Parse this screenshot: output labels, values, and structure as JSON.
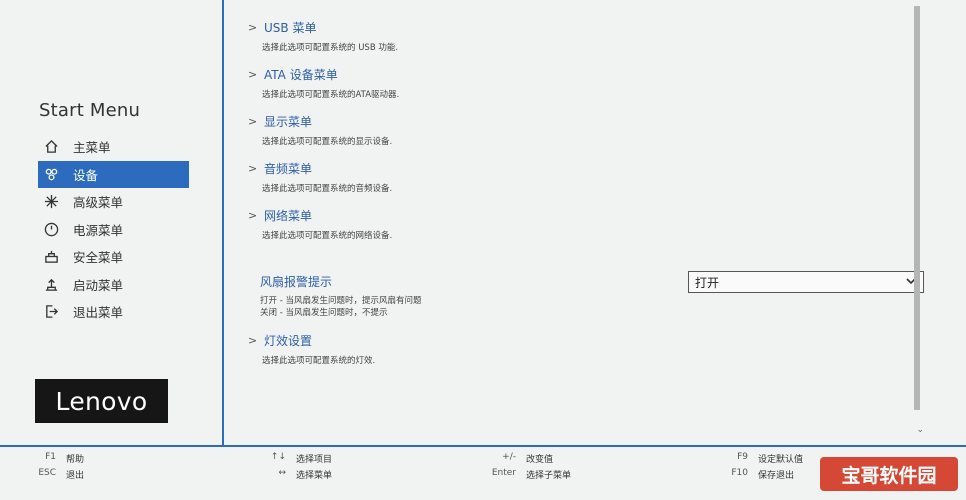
{
  "sidebar": {
    "title": "Start Menu",
    "items": [
      {
        "label": "主菜单",
        "icon": "home-icon"
      },
      {
        "label": "设备",
        "icon": "devices-icon",
        "active": true
      },
      {
        "label": "高级菜单",
        "icon": "advanced-icon"
      },
      {
        "label": "电源菜单",
        "icon": "power-icon"
      },
      {
        "label": "安全菜单",
        "icon": "security-icon"
      },
      {
        "label": "启动菜单",
        "icon": "startup-icon"
      },
      {
        "label": "退出菜单",
        "icon": "exit-icon"
      }
    ],
    "logo": "Lenovo"
  },
  "main": {
    "entries": [
      {
        "title": "USB 菜单",
        "desc": "选择此选项可配置系统的 USB 功能."
      },
      {
        "title": "ATA 设备菜单",
        "desc": "选择此选项可配置系统的ATA驱动器."
      },
      {
        "title": "显示菜单",
        "desc": "选择此选项可配置系统的显示设备."
      },
      {
        "title": "音频菜单",
        "desc": "选择此选项可配置系统的音频设备."
      },
      {
        "title": "网络菜单",
        "desc": "选择此选项可配置系统的网络设备."
      }
    ],
    "fan": {
      "title": "风扇报警提示",
      "desc_on": "打开 - 当风扇发生问题时，提示风扇有问题",
      "desc_off": "关闭 - 当风扇发生问题时，不提示",
      "value": "打开"
    },
    "light": {
      "title": "灯效设置",
      "desc": "选择此选项可配置系统的灯效."
    }
  },
  "footer": {
    "keys": [
      {
        "key": "F1",
        "label": "帮助"
      },
      {
        "key": "ESC",
        "label": "退出"
      },
      {
        "key": "↑↓",
        "label": "选择项目"
      },
      {
        "key": "↔",
        "label": "选择菜单"
      },
      {
        "key": "+/-",
        "label": "改变值"
      },
      {
        "key": "Enter",
        "label": "选择子菜单"
      },
      {
        "key": "F9",
        "label": "设定默认值"
      },
      {
        "key": "F10",
        "label": "保存退出"
      }
    ]
  },
  "watermark": "宝哥软件园",
  "colors": {
    "accent": "#2d6bbf",
    "background": "#f1f2f2",
    "link": "#2d5fae"
  }
}
